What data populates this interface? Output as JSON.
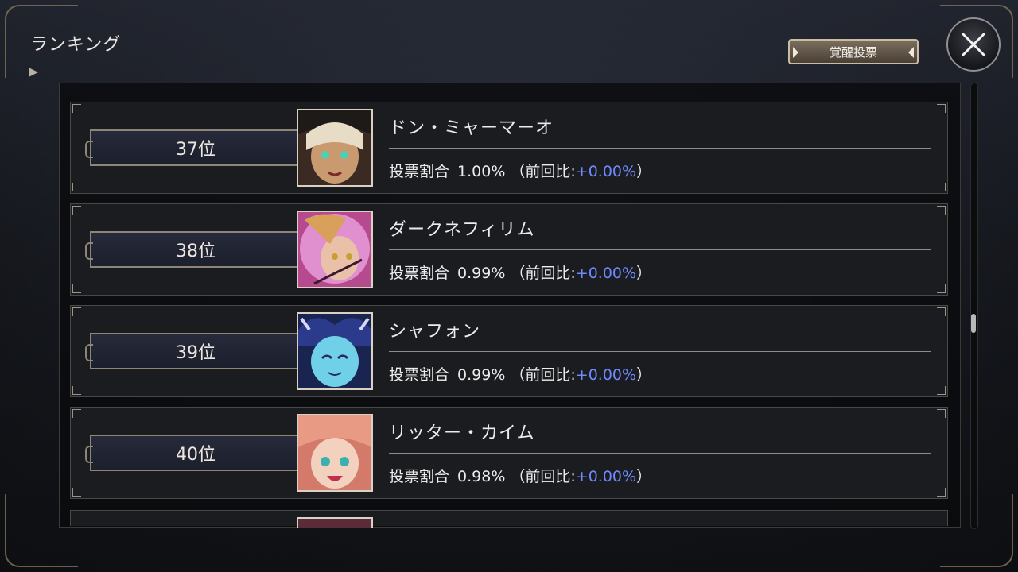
{
  "header": {
    "title": "ランキング",
    "vote_button_label": "覚醒投票"
  },
  "ranking": [
    {
      "rank": "37位",
      "name": "ドン・ミャーマーオ",
      "ratio_label": "投票割合",
      "ratio": "1.00%",
      "prev_open": "（前回比:",
      "diff": "+0.00%",
      "prev_close": "）",
      "portrait_icon": "character-portrait-don-myamao"
    },
    {
      "rank": "38位",
      "name": "ダークネフィリム",
      "ratio_label": "投票割合",
      "ratio": "0.99%",
      "prev_open": "（前回比:",
      "diff": "+0.00%",
      "prev_close": "）",
      "portrait_icon": "character-portrait-dark-nephilim"
    },
    {
      "rank": "39位",
      "name": "シャフォン",
      "ratio_label": "投票割合",
      "ratio": "0.99%",
      "prev_open": "（前回比:",
      "diff": "+0.00%",
      "prev_close": "）",
      "portrait_icon": "character-portrait-chiffon"
    },
    {
      "rank": "40位",
      "name": "リッター・カイム",
      "ratio_label": "投票割合",
      "ratio": "0.98%",
      "prev_open": "（前回比:",
      "diff": "+0.00%",
      "prev_close": "）",
      "portrait_icon": "character-portrait-ritter-keim"
    }
  ],
  "colors": {
    "diff_text": "#6f89ff",
    "row_bg": "#1b1c1f",
    "rank_plate_bg": "#20232f"
  }
}
